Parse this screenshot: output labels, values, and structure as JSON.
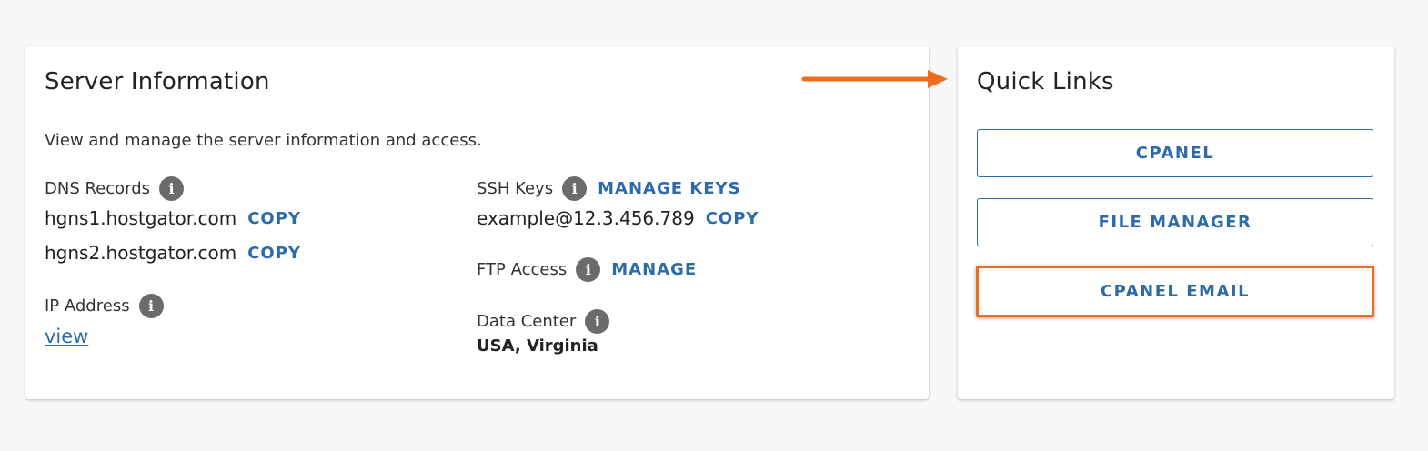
{
  "server_info": {
    "title": "Server Information",
    "description": "View and manage the server information and access.",
    "dns": {
      "label": "DNS Records",
      "records": [
        {
          "value": "hgns1.hostgator.com",
          "action": "COPY"
        },
        {
          "value": "hgns2.hostgator.com",
          "action": "COPY"
        }
      ]
    },
    "ip": {
      "label": "IP Address",
      "link": "view"
    },
    "ssh": {
      "label": "SSH Keys",
      "action": "MANAGE KEYS",
      "value": "example@12.3.456.789",
      "copy": "COPY"
    },
    "ftp": {
      "label": "FTP Access",
      "action": "MANAGE"
    },
    "datacenter": {
      "label": "Data Center",
      "value": "USA, Virginia"
    }
  },
  "quick_links": {
    "title": "Quick Links",
    "buttons": [
      "CPANEL",
      "FILE MANAGER",
      "CPANEL EMAIL"
    ]
  },
  "colors": {
    "accent": "#2d6aaa",
    "annotation": "#ef6c1d",
    "info_icon": "#6b6b6b"
  },
  "icons": {
    "info": "info-icon",
    "arrow": "arrow-right-icon"
  }
}
